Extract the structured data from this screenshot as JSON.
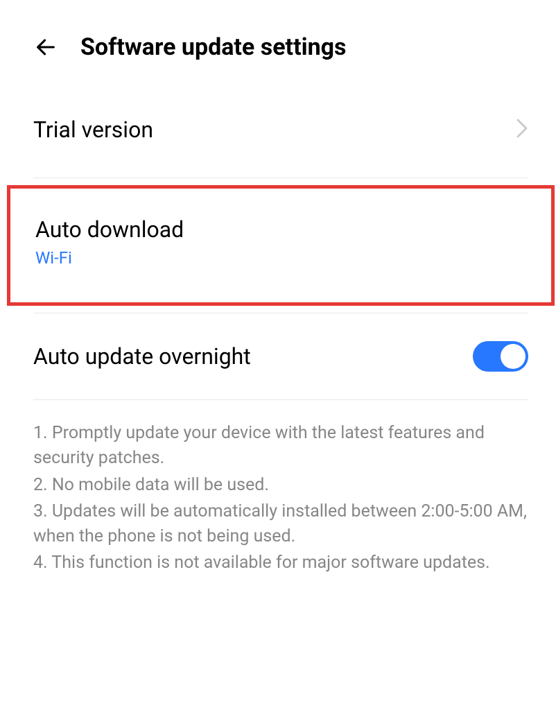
{
  "header": {
    "title": "Software update settings"
  },
  "items": {
    "trial": {
      "label": "Trial version"
    },
    "auto_download": {
      "label": "Auto download",
      "value": "Wi-Fi"
    },
    "auto_update": {
      "label": "Auto update overnight"
    }
  },
  "notes": {
    "line1": "1. Promptly update your device with the latest features and security patches.",
    "line2": "2. No mobile data will be used.",
    "line3": "3. Updates will be automatically installed between 2:00-5:00 AM, when the phone is not being used.",
    "line4": "4. This function is not available for major software updates."
  }
}
